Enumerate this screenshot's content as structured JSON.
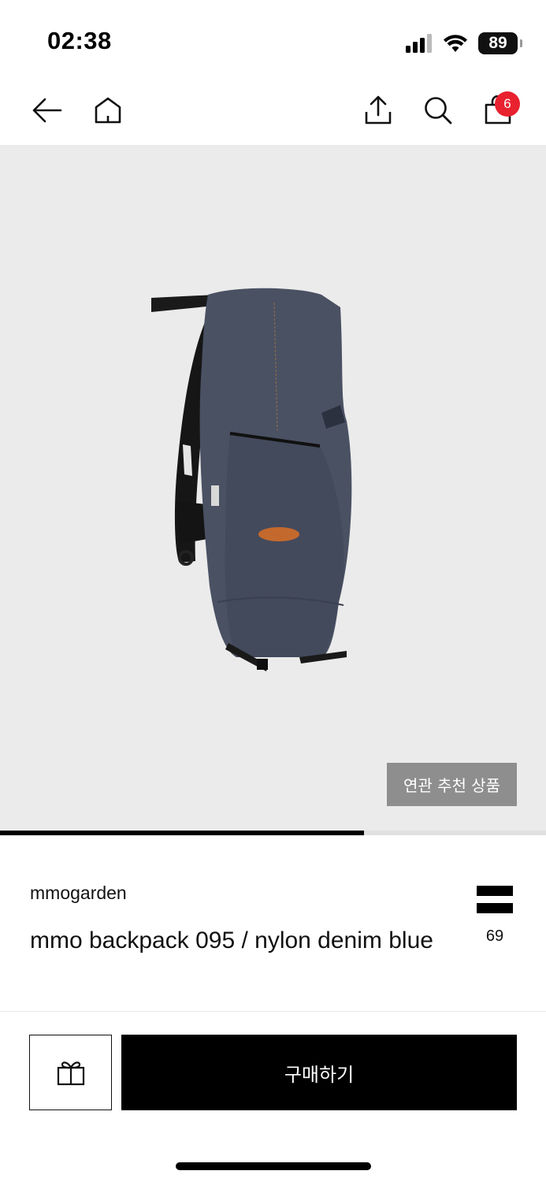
{
  "status_bar": {
    "time": "02:38",
    "battery": "89",
    "icons": [
      "cellular-signal-icon",
      "wifi-icon",
      "battery-icon"
    ]
  },
  "nav": {
    "icons": [
      "back-arrow-icon",
      "home-icon",
      "share-icon",
      "search-icon",
      "cart-icon"
    ],
    "cart_count": "6"
  },
  "product_image": {
    "related_button_label": "연관 추천 상품",
    "carousel_progress": 0.667
  },
  "product": {
    "brand": "mmogarden",
    "title": "mmo backpack 095 / nylon denim blue",
    "like_count": "69",
    "like_icon": "bookmark-bars-icon"
  },
  "actions": {
    "gift_icon": "gift-icon",
    "buy_label": "구매하기"
  },
  "colors": {
    "accent_badge": "#e8222f",
    "buy_button": "#000000",
    "image_background": "#ebebeb"
  }
}
